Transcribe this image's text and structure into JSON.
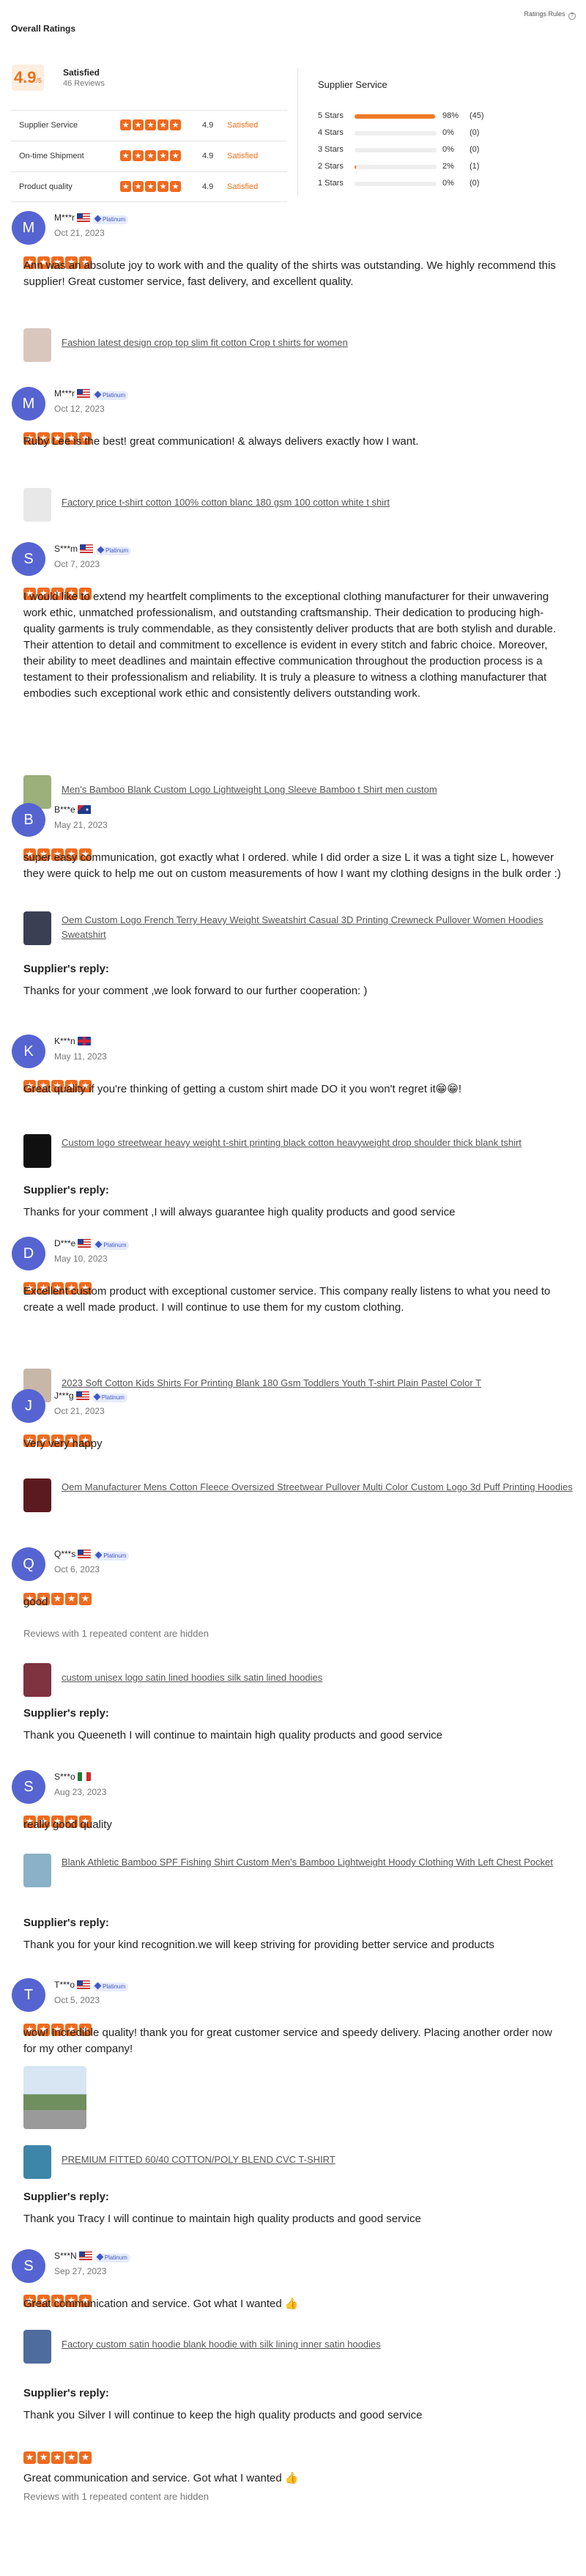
{
  "header": {
    "title": "Overall Ratings",
    "rules_label": "Ratings Rules",
    "help_icon": "?"
  },
  "summary": {
    "score": "4.9",
    "score_max": "/5",
    "label": "Satisfied",
    "count": "46 Reviews",
    "categories": [
      {
        "label": "Supplier Service",
        "value": "4.9",
        "status": "Satisfied",
        "stars": 5
      },
      {
        "label": "On-time Shipment",
        "value": "4.9",
        "status": "Satisfied",
        "stars": 5
      },
      {
        "label": "Product quality",
        "value": "4.9",
        "status": "Satisfied",
        "stars": 5
      }
    ],
    "service_title": "Supplier Service",
    "distribution": [
      {
        "label": "5 Stars",
        "pct": "98%",
        "count": "(45)",
        "fill": 0.98
      },
      {
        "label": "4 Stars",
        "pct": "0%",
        "count": "(0)",
        "fill": 0
      },
      {
        "label": "3 Stars",
        "pct": "0%",
        "count": "(0)",
        "fill": 0
      },
      {
        "label": "2 Stars",
        "pct": "2%",
        "count": "(1)",
        "fill": 0.02
      },
      {
        "label": "1 Stars",
        "pct": "0%",
        "count": "(0)",
        "fill": 0
      }
    ]
  },
  "reviews": [
    {
      "initial": "M",
      "name": "M***r",
      "flag": "us",
      "badge": "Platinum",
      "date": "Oct 21, 2023",
      "text": "Ann was an absolute joy to work with and the quality of the shirts was outstanding. We highly recommend this supplier! Great customer service, fast delivery, and excellent quality.",
      "product": "Fashion latest design crop top slim fit cotton Crop t shirts for women"
    },
    {
      "initial": "M",
      "name": "M***r",
      "flag": "us",
      "badge": "Platinum",
      "date": "Oct 12, 2023",
      "text": "Ruby Lee is the best! great communication! & always delivers exactly how I want.",
      "product": "Factory price t-shirt cotton 100% cotton blanc 180 gsm 100 cotton white t shirt"
    },
    {
      "initial": "S",
      "name": "S***m",
      "flag": "us",
      "badge": "Platinum",
      "date": "Oct 7, 2023",
      "text": "I would like to extend my heartfelt compliments to the exceptional clothing manufacturer for their unwavering work ethic, unmatched professionalism, and outstanding craftsmanship. Their dedication to producing high-quality garments is truly commendable, as they consistently deliver products that are both stylish and durable. Their attention to detail and commitment to excellence is evident in every stitch and fabric choice. Moreover, their ability to meet deadlines and maintain effective communication throughout the production process is a testament to their professionalism and reliability. It is truly a pleasure to witness a clothing manufacturer that embodies such exceptional work ethic and consistently delivers outstanding work.",
      "product": "Men's Bamboo Blank Custom Logo Lightweight Long Sleeve Bamboo t Shirt men custom"
    },
    {
      "initial": "B",
      "name": "B***e",
      "flag": "au",
      "date": "May 21, 2023",
      "text": "super easy communication, got exactly what I ordered. while I did order a size L it was a tight size L, however they were quick to help me out on custom measurements of how I want my clothing designs in the bulk order :)",
      "product": "Oem Custom Logo French Terry Heavy Weight Sweatshirt Casual 3D Printing Crewneck Pullover Women Hoodies Sweatshirt",
      "reply_title": "Supplier's reply:",
      "reply": "Thanks for your comment ,we look forward to our further cooperation: )"
    },
    {
      "initial": "K",
      "name": "K***n",
      "flag": "gb",
      "date": "May 11, 2023",
      "text": "Great quality if you're thinking of getting a custom shirt made DO it you won't regret it😁😁!",
      "product": "Custom logo streetwear heavy weight t-shirt printing black cotton heavyweight drop shoulder thick blank tshirt",
      "reply_title": "Supplier's reply:",
      "reply": "Thanks for your comment ,I will always guarantee high quality products and good service"
    },
    {
      "initial": "D",
      "name": "D***e",
      "flag": "us",
      "badge": "Platinum",
      "date": "May 10, 2023",
      "text": "Excellent custom product with exceptional customer service. This company really listens to what you need to create a well made product. I will continue to use them for my custom clothing.",
      "product": "2023 Soft Cotton Kids Shirts For Printing Blank 180 Gsm Toddlers Youth T-shirt Plain Pastel Color T"
    },
    {
      "initial": "J",
      "name": "J***g",
      "flag": "us",
      "badge": "Platinum",
      "date": "Oct 21, 2023",
      "text": "Very very happy",
      "product": "Oem Manufacturer Mens Cotton Fleece Oversized Streetwear Pullover Multi Color Custom Logo 3d Puff Printing Hoodies"
    },
    {
      "initial": "Q",
      "name": "Q***s",
      "flag": "us",
      "badge": "Platinum",
      "date": "Oct 6, 2023",
      "text": "good",
      "meta": "Reviews with 1 repeated content are hidden",
      "product": "custom unisex logo satin lined hoodies silk satin lined hoodies",
      "reply_title": "Supplier's reply:",
      "reply": "Thank you Queeneth I will continue to maintain high quality products and good service"
    },
    {
      "initial": "S",
      "name": "S***o",
      "flag": "mx",
      "date": "Aug 23, 2023",
      "text": "really good quality",
      "product": "Blank Athletic Bamboo SPF Fishing Shirt Custom Men's Bamboo Lightweight Hoody Clothing With Left Chest Pocket",
      "reply_title": "Supplier's reply:",
      "reply": "Thank you for your kind recognition.we will keep striving for providing better service and products"
    },
    {
      "initial": "T",
      "name": "T***o",
      "flag": "us",
      "badge": "Platinum",
      "date": "Oct 5, 2023",
      "text": "wow! Incredible quality! thank you for great customer service and speedy delivery. Placing another order now for my other company!",
      "product": "PREMIUM FITTED 60/40 COTTON/POLY BLEND CVC T-SHIRT",
      "reply_title": "Supplier's reply:",
      "reply": "Thank you Tracy I will continue to maintain high quality products and good service"
    },
    {
      "initial": "S",
      "name": "S***N",
      "flag": "us",
      "badge": "Platinum",
      "date": "Sep 27, 2023",
      "text": "Great communication and service. Got what I wanted 👍",
      "product": "Factory custom satin hoodie blank hoodie with silk lining inner satin hoodies",
      "reply_title": "Supplier's reply:",
      "reply": "Thank you Silver I will continue to keep the high quality products and good service"
    },
    {
      "text": "Great communication and service. Got what I wanted 👍",
      "meta": "Reviews with 1 repeated content are hidden"
    }
  ],
  "colors": {
    "accent": "#ef6a1e",
    "avatar": "#5564d1",
    "badge": "#3f59c9"
  }
}
